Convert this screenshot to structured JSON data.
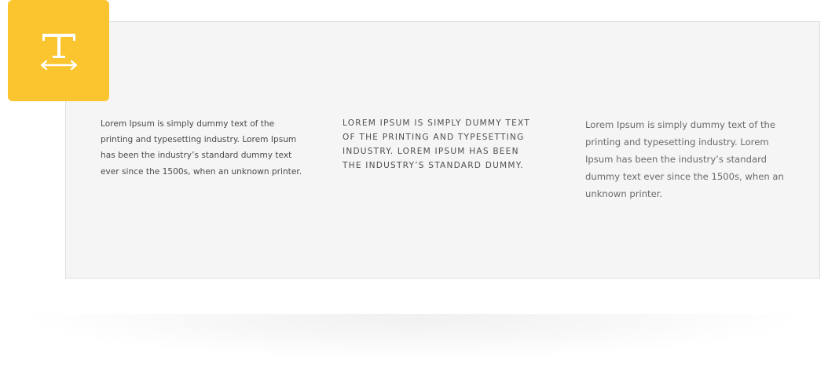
{
  "badge": {
    "icon": "text-width-icon",
    "color": "#fbc52f"
  },
  "panel": {
    "background": "#f5f5f5"
  },
  "columns": [
    {
      "style": "small-regular",
      "text": "Lorem Ipsum is simply dummy text of the printing and typesetting industry. Lorem Ipsum has been the industry’s standard dummy text ever since the 1500s, when an unknown printer."
    },
    {
      "style": "uppercase-spaced",
      "text": "Lorem Ipsum is simply dummy text of the printing and typesetting industry. Lorem Ipsum has been the industry’s standard dummy."
    },
    {
      "style": "light-large",
      "text": "Lorem Ipsum is simply dummy text of the printing and typesetting industry. Lorem Ipsum has been the industry’s standard dummy text ever since the 1500s, when an unknown printer."
    }
  ]
}
